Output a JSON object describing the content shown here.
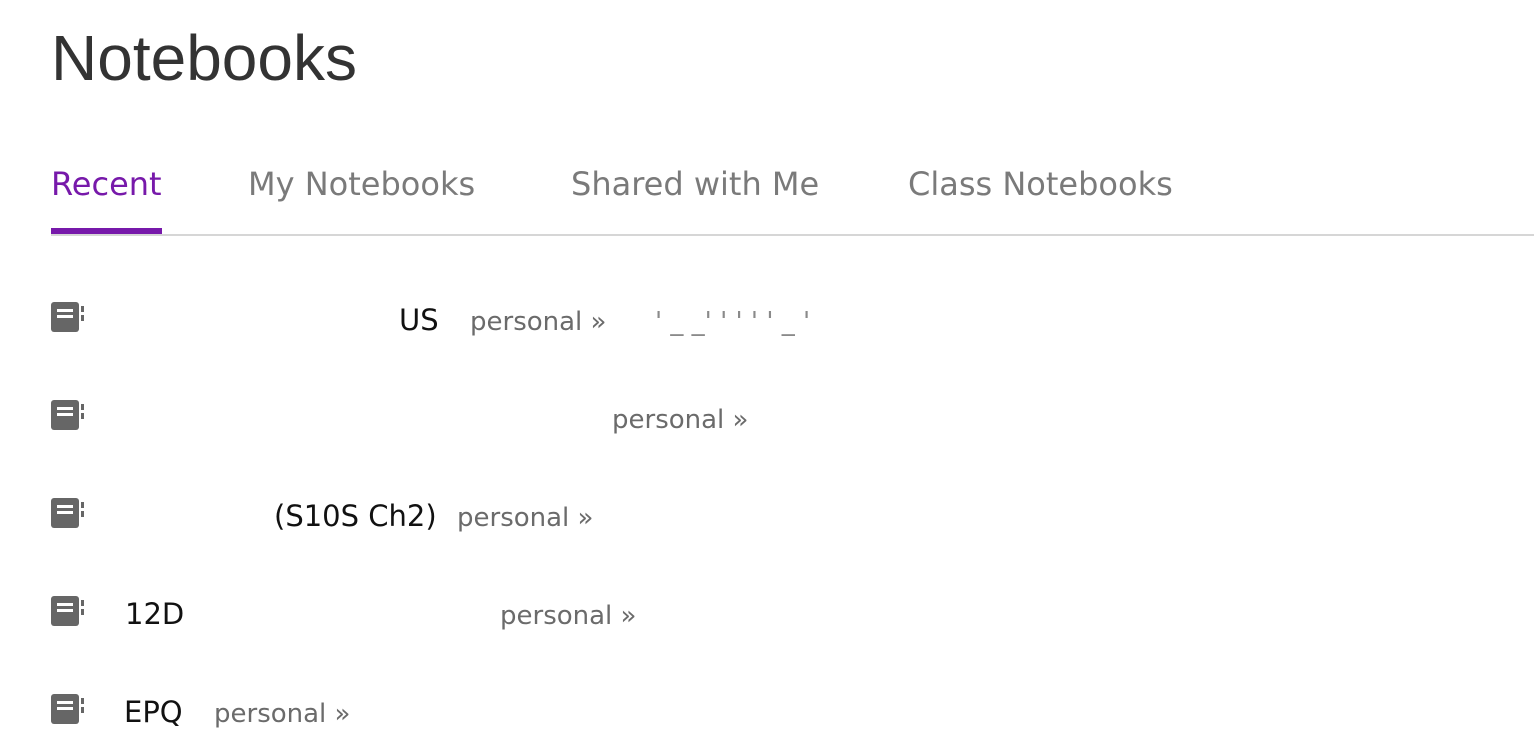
{
  "header": {
    "title": "Notebooks"
  },
  "tabs": [
    {
      "label": "Recent",
      "active": true
    },
    {
      "label": "My Notebooks",
      "active": false
    },
    {
      "label": "Shared with Me",
      "active": false
    },
    {
      "label": "Class Notebooks",
      "active": false
    }
  ],
  "colors": {
    "accent": "#7719aa",
    "tab_inactive": "#7a7a7a",
    "icon": "#666666"
  },
  "notebooks": [
    {
      "name": "US",
      "owner": "personal »",
      "path": "' _ _' ' ' ' ' _ '",
      "icon": "notebook-icon"
    },
    {
      "name": "",
      "owner": "personal »",
      "path": "",
      "icon": "notebook-icon"
    },
    {
      "name": "(S10S Ch2)",
      "owner": "personal »",
      "path": "",
      "icon": "notebook-icon"
    },
    {
      "name": "12D",
      "owner": "personal »",
      "path": "",
      "icon": "notebook-icon"
    },
    {
      "name": "EPQ",
      "owner": "personal »",
      "path": "",
      "icon": "notebook-icon"
    }
  ]
}
